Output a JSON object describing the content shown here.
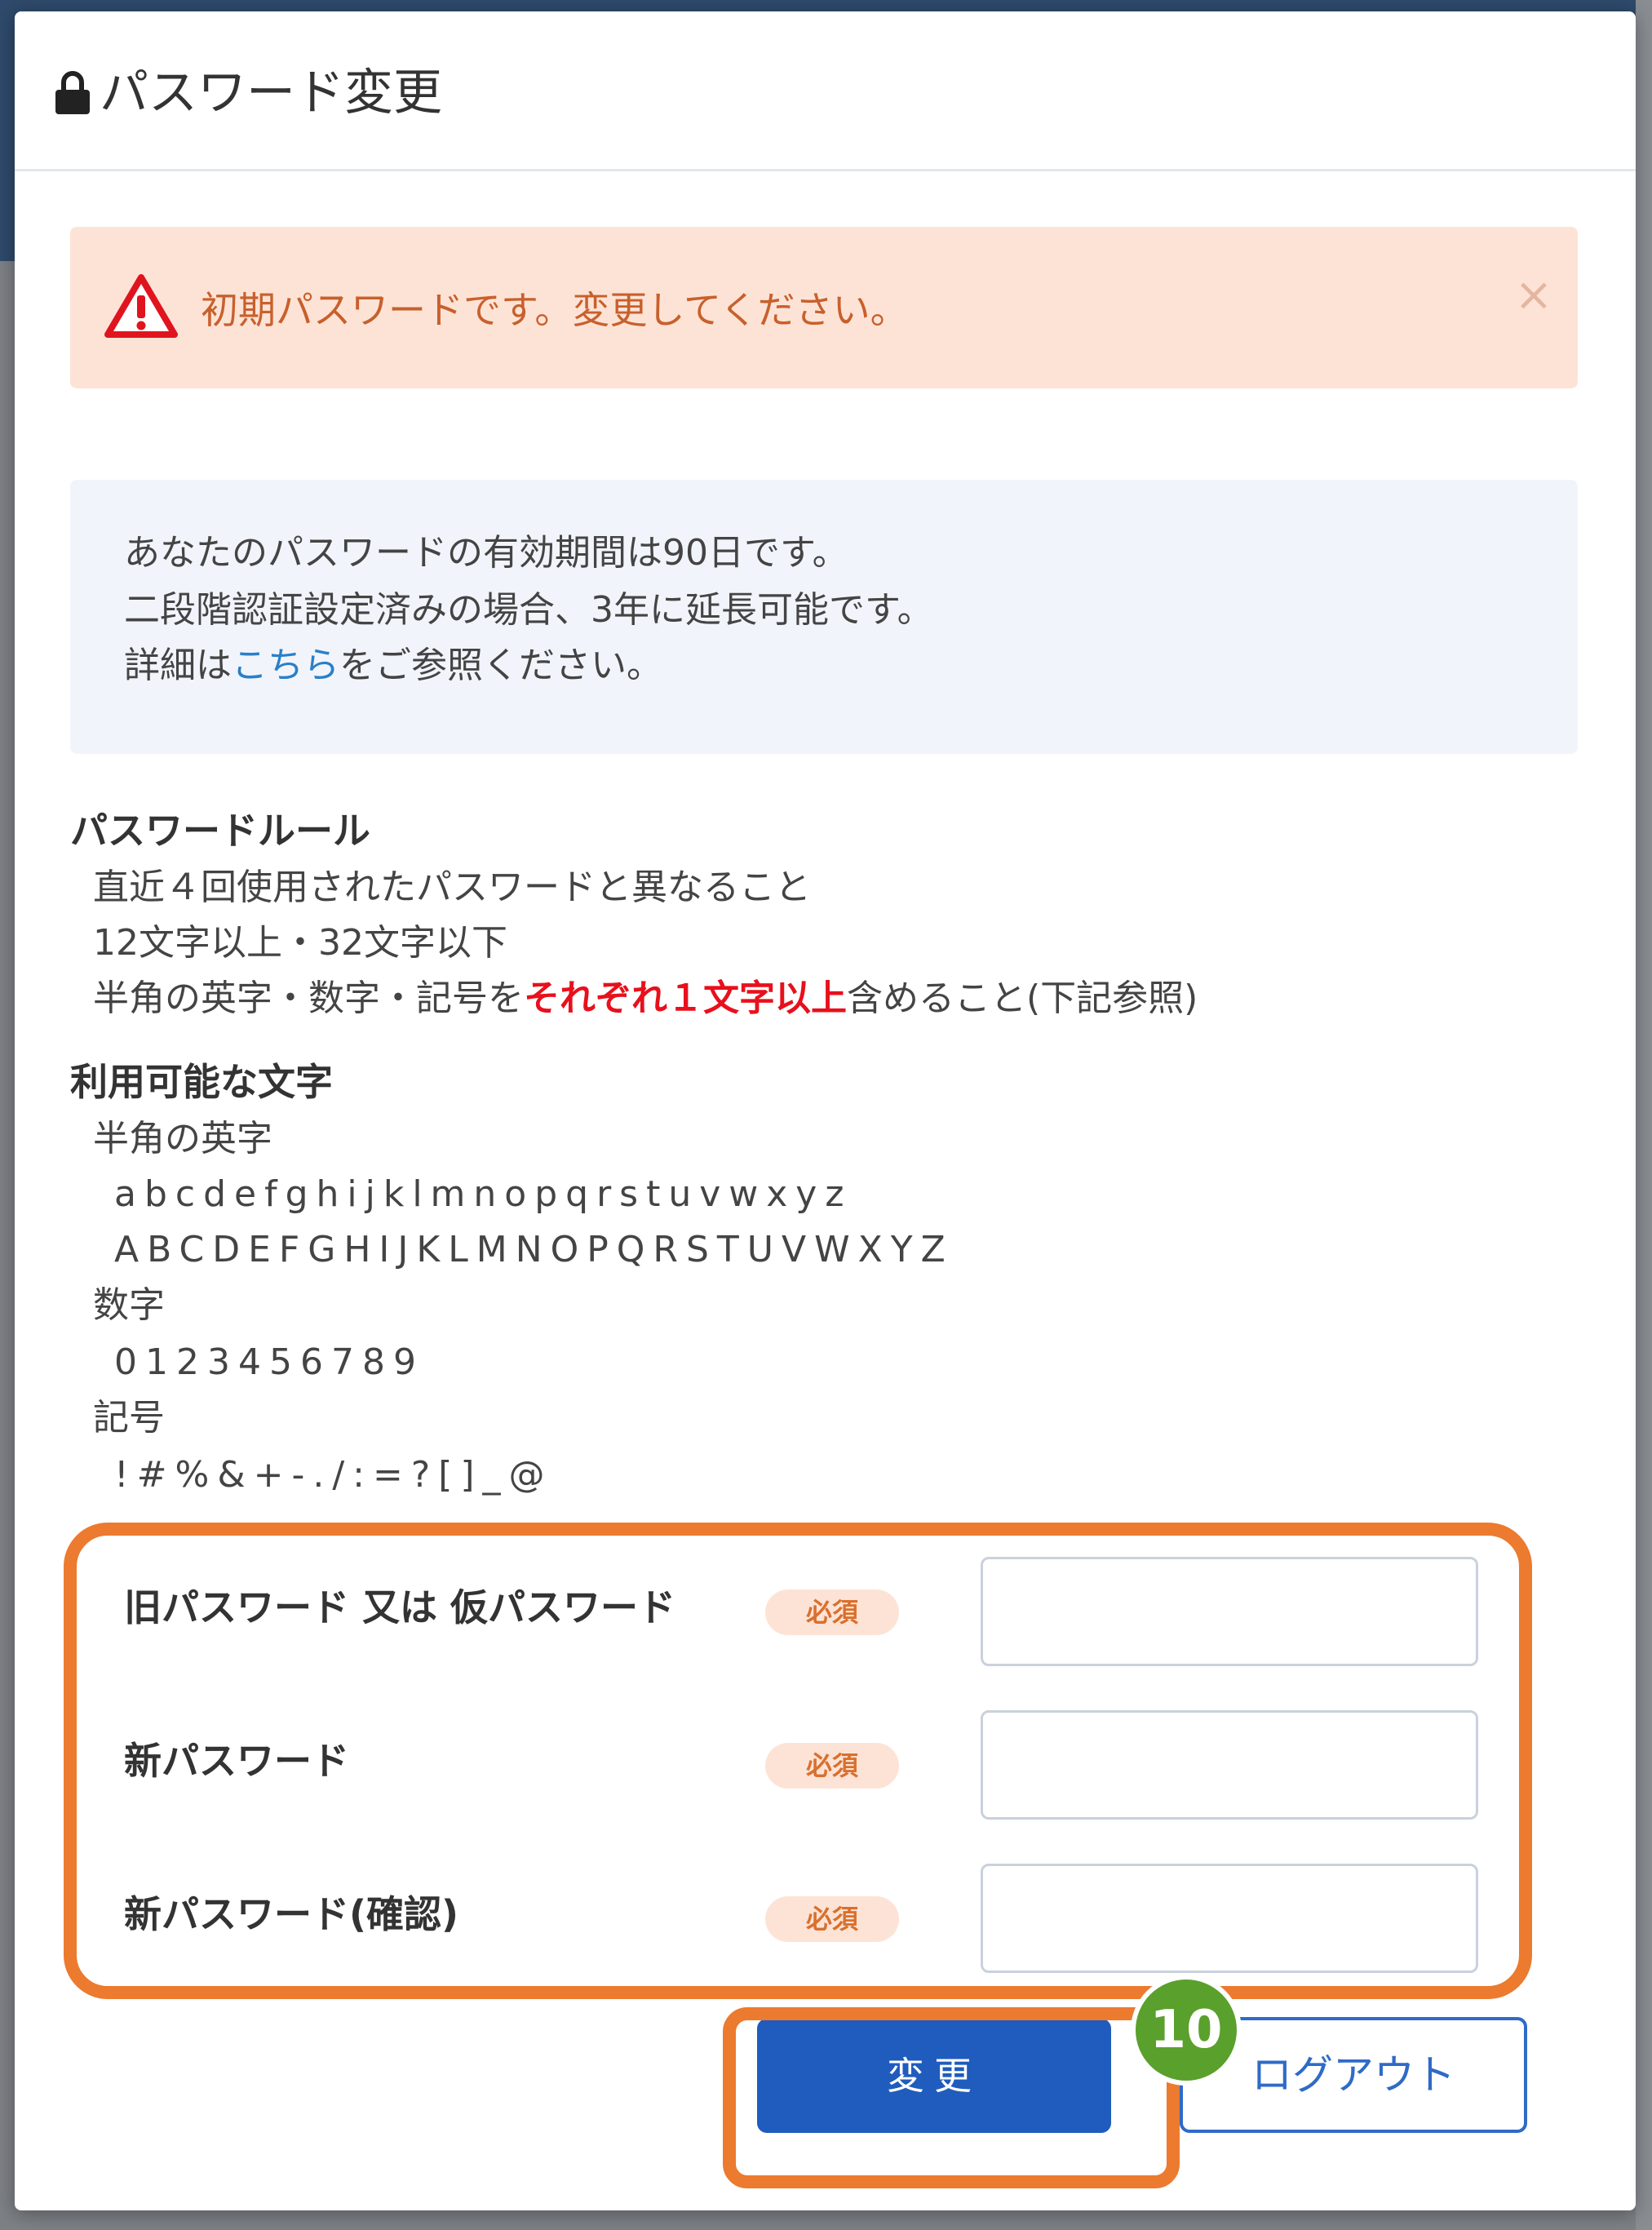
{
  "modal": {
    "title": "パスワード変更"
  },
  "alert": {
    "message": "初期パスワードです。変更してください。",
    "close": "×"
  },
  "info": {
    "line1": "あなたのパスワードの有効期間は90日です。",
    "line2": "二段階認証設定済みの場合、3年に延長可能です。",
    "line3_prefix": "詳細は",
    "line3_link": "こちら",
    "line3_suffix": "をご参照ください。"
  },
  "rules": {
    "heading": "パスワードルール",
    "item1": "直近４回使用されたパスワードと異なること",
    "item2": "12文字以上・32文字以下",
    "item3_prefix": "半角の英字・数字・記号を",
    "item3_emphasis": "それぞれ１文字以上",
    "item3_suffix": "含めること(下記参照)"
  },
  "chars": {
    "heading": "利用可能な文字",
    "alpha_label": "半角の英字",
    "lowercase": "abcdefghijklmnopqrstuvwxyz",
    "uppercase": "ABCDEFGHIJKLMNOPQRSTUVWXYZ",
    "digit_label": "数字",
    "digits": "0123456789",
    "symbol_label": "記号",
    "symbols": "!#%&+-./:=?[]_@"
  },
  "form": {
    "required_label": "必須",
    "fields": [
      {
        "label": "旧パスワード 又は 仮パスワード",
        "value": ""
      },
      {
        "label": "新パスワード",
        "value": ""
      },
      {
        "label": "新パスワード(確認)",
        "value": ""
      }
    ]
  },
  "buttons": {
    "submit": "変更",
    "logout": "ログアウト"
  },
  "annotation": {
    "step": "10",
    "highlight_color": "#ec7a2f",
    "badge_color": "#5aa02c"
  },
  "colors": {
    "primary": "#1f5cbd",
    "alert_bg": "#fde3d6",
    "alert_text": "#c8602c",
    "emphasis": "#e8101c",
    "link": "#2a7fc9"
  }
}
